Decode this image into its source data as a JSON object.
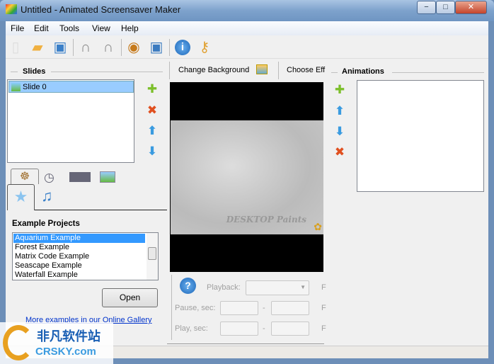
{
  "window": {
    "title": "Untitled - Animated Screensaver Maker",
    "minimize": "−",
    "maximize": "□",
    "close": "✕"
  },
  "menu": [
    "File",
    "Edit",
    "Tools",
    "View",
    "Help"
  ],
  "toolbar": [
    "new-icon",
    "open-icon",
    "save-icon",
    "undo-icon",
    "redo-icon",
    "preview-icon",
    "install-screensaver-icon",
    "about-icon",
    "register-key-icon"
  ],
  "slides": {
    "header": "Slides",
    "items": [
      "Slide 0"
    ]
  },
  "examples": {
    "header": "Example Projects",
    "items": [
      "Aquarium Example",
      "Forest Example",
      "Matrix Code Example",
      "Seascape Example",
      "Waterfall Example"
    ],
    "selected": 0,
    "open_label": "Open",
    "gallery_link": "More examples in our Online Gallery"
  },
  "center": {
    "change_background": "Change Background",
    "choose_effect": "Choose Eff",
    "preview_watermark": "DESKTOP Paints",
    "playback_label": "Playback:",
    "pause_label": "Pause, sec:",
    "play_label": "Play, sec:",
    "dash": "-",
    "f": "F"
  },
  "animations": {
    "header": "Animations"
  },
  "watermark": {
    "cn": "非凡软件站",
    "en": "CRSKY.com"
  }
}
